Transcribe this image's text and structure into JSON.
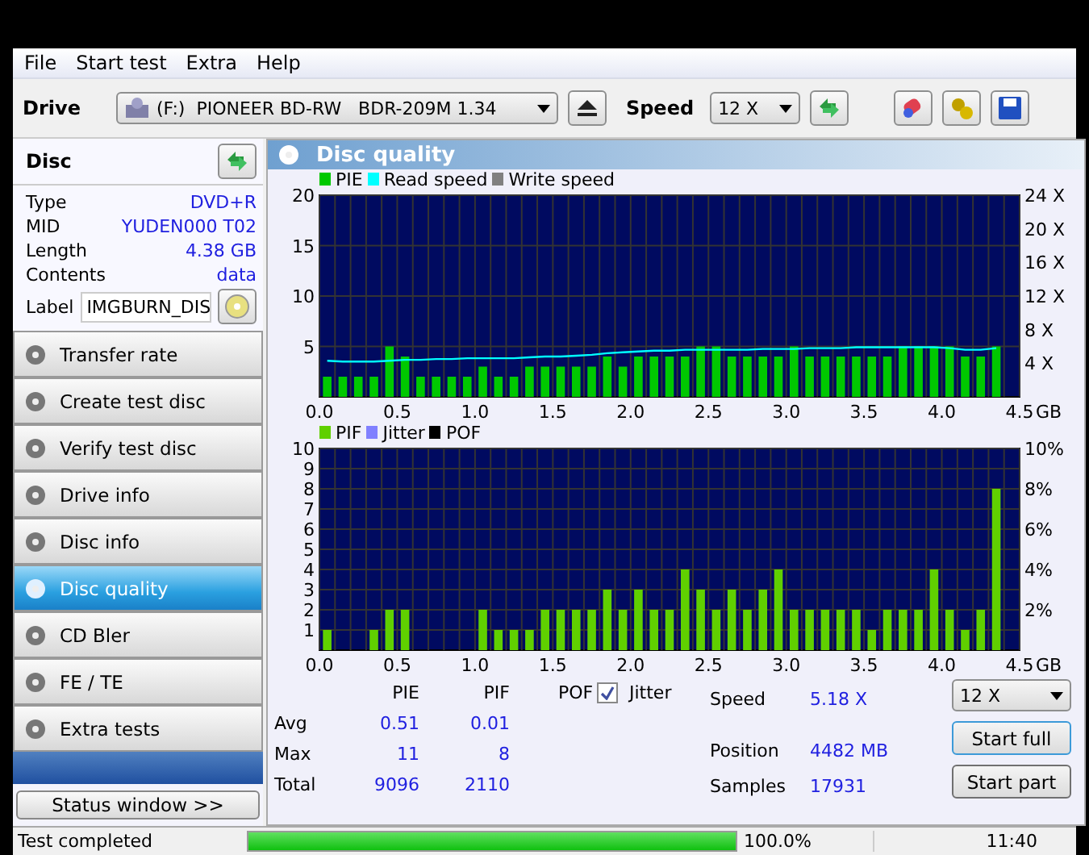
{
  "menu": [
    "File",
    "Start test",
    "Extra",
    "Help"
  ],
  "toolbar": {
    "drive_label": "Drive",
    "drive": "(F:)  PIONEER BD-RW   BDR-209M 1.34",
    "speed_label": "Speed",
    "speed": "12 X"
  },
  "disc": {
    "title": "Disc",
    "fields": [
      {
        "label": "Type",
        "value": "DVD+R"
      },
      {
        "label": "MID",
        "value": "YUDEN000 T02"
      },
      {
        "label": "Length",
        "value": "4.38 GB"
      },
      {
        "label": "Contents",
        "value": "data"
      }
    ],
    "label_label": "Label",
    "label_value": "IMGBURN_DIS"
  },
  "nav": [
    {
      "label": "Transfer rate",
      "selected": false
    },
    {
      "label": "Create test disc",
      "selected": false
    },
    {
      "label": "Verify test disc",
      "selected": false
    },
    {
      "label": "Drive info",
      "selected": false
    },
    {
      "label": "Disc info",
      "selected": false
    },
    {
      "label": "Disc quality",
      "selected": true
    },
    {
      "label": "CD Bler",
      "selected": false
    },
    {
      "label": "FE / TE",
      "selected": false
    },
    {
      "label": "Extra tests",
      "selected": false
    }
  ],
  "status_window": "Status window >>",
  "panel_title": "Disc quality",
  "top_chart": {
    "extra_legend": [
      {
        "name": "Write speed",
        "color": "#808080"
      }
    ],
    "xunit": "GB",
    "chart_data": {
      "type": "bar",
      "grid": true,
      "xlim": [
        0,
        4.5
      ],
      "ylim": [
        0,
        20
      ],
      "y2lim": [
        0,
        24
      ],
      "y2ticks": [
        {
          "value": 24,
          "label": "24 X"
        },
        {
          "value": 20,
          "label": "20 X"
        },
        {
          "value": 16,
          "label": "16 X"
        },
        {
          "value": 12,
          "label": "12 X"
        },
        {
          "value": 8,
          "label": "8 X"
        },
        {
          "value": 4,
          "label": "4 X"
        }
      ],
      "xticks": [
        {
          "value": 0,
          "label": "0.0"
        },
        0.5,
        {
          "value": 1,
          "label": "1.0"
        },
        1.5,
        {
          "value": 2,
          "label": "2.0"
        },
        2.5,
        {
          "value": 3,
          "label": "3.0"
        },
        3.5,
        {
          "value": 4,
          "label": "4.0"
        },
        4.5
      ],
      "yticks": [
        5,
        10,
        15,
        20
      ],
      "x": [
        0.05,
        0.15,
        0.25,
        0.35,
        0.45,
        0.55,
        0.65,
        0.75,
        0.85,
        0.95,
        1.05,
        1.15,
        1.25,
        1.35,
        1.45,
        1.55,
        1.65,
        1.75,
        1.85,
        1.95,
        2.05,
        2.15,
        2.25,
        2.35,
        2.45,
        2.55,
        2.65,
        2.75,
        2.85,
        2.95,
        3.05,
        3.15,
        3.25,
        3.35,
        3.45,
        3.55,
        3.65,
        3.75,
        3.85,
        3.95,
        4.05,
        4.15,
        4.25,
        4.35
      ],
      "series": [
        {
          "name": "PIE",
          "color": "#00c800",
          "values": [
            2,
            2,
            2,
            2,
            5,
            4,
            2,
            2,
            2,
            2,
            3,
            2,
            2,
            3,
            3,
            3,
            3,
            3,
            4,
            3,
            4,
            4,
            4,
            4,
            5,
            5,
            4,
            4,
            4,
            4,
            5,
            4,
            4,
            4,
            4,
            4,
            4,
            5,
            5,
            5,
            5,
            4,
            4,
            5
          ]
        },
        {
          "name": "Read speed",
          "color": "#00ffff",
          "type": "line",
          "axis": "y2",
          "values": [
            4.3,
            4.2,
            4.2,
            4.2,
            4.3,
            4.4,
            4.4,
            4.5,
            4.5,
            4.6,
            4.6,
            4.6,
            4.6,
            4.7,
            4.8,
            4.8,
            4.9,
            5.0,
            5.2,
            5.3,
            5.4,
            5.5,
            5.5,
            5.6,
            5.6,
            5.6,
            5.6,
            5.6,
            5.7,
            5.7,
            5.7,
            5.8,
            5.8,
            5.8,
            5.9,
            5.9,
            5.9,
            5.9,
            5.9,
            5.9,
            5.8,
            5.6,
            5.6,
            5.8
          ]
        }
      ]
    }
  },
  "bottom_chart": {
    "extra_legend": [
      {
        "name": "Jitter",
        "color": "#8080ff"
      },
      {
        "name": "POF",
        "color": "#000000"
      }
    ],
    "xunit": "GB",
    "chart_data": {
      "type": "bar",
      "grid": true,
      "xlim": [
        0,
        4.5
      ],
      "ylim": [
        0,
        10
      ],
      "y2lim": [
        0,
        10
      ],
      "y2ticks": [
        {
          "value": 10,
          "label": "10%"
        },
        {
          "value": 8,
          "label": "8%"
        },
        {
          "value": 6,
          "label": "6%"
        },
        {
          "value": 4,
          "label": "4%"
        },
        {
          "value": 2,
          "label": "2%"
        }
      ],
      "xticks": [
        {
          "value": 0,
          "label": "0.0"
        },
        0.5,
        {
          "value": 1,
          "label": "1.0"
        },
        1.5,
        {
          "value": 2,
          "label": "2.0"
        },
        2.5,
        {
          "value": 3,
          "label": "3.0"
        },
        3.5,
        {
          "value": 4,
          "label": "4.0"
        },
        4.5
      ],
      "yticks": [
        1,
        2,
        3,
        4,
        5,
        6,
        7,
        8,
        9,
        10
      ],
      "x": [
        0.05,
        0.15,
        0.25,
        0.35,
        0.45,
        0.55,
        0.65,
        0.75,
        0.85,
        0.95,
        1.05,
        1.15,
        1.25,
        1.35,
        1.45,
        1.55,
        1.65,
        1.75,
        1.85,
        1.95,
        2.05,
        2.15,
        2.25,
        2.35,
        2.45,
        2.55,
        2.65,
        2.75,
        2.85,
        2.95,
        3.05,
        3.15,
        3.25,
        3.35,
        3.45,
        3.55,
        3.65,
        3.75,
        3.85,
        3.95,
        4.05,
        4.15,
        4.25,
        4.35
      ],
      "series": [
        {
          "name": "PIF",
          "color": "#60d000",
          "values": [
            1,
            0,
            0,
            1,
            2,
            2,
            0,
            0,
            0,
            0,
            2,
            1,
            1,
            1,
            2,
            2,
            2,
            2,
            3,
            2,
            3,
            2,
            2,
            4,
            3,
            2,
            3,
            2,
            3,
            4,
            2,
            2,
            2,
            2,
            2,
            1,
            2,
            2,
            2,
            4,
            2,
            1,
            2,
            8
          ]
        }
      ]
    }
  },
  "stats": {
    "columns": [
      "PIE",
      "PIF",
      "POF"
    ],
    "jitter": {
      "label": "Jitter",
      "checked": true
    },
    "rows": [
      {
        "label": "Avg",
        "values": [
          "0.51",
          "0.01"
        ]
      },
      {
        "label": "Max",
        "values": [
          "11",
          "8"
        ]
      },
      {
        "label": "Total",
        "values": [
          "9096",
          "2110"
        ]
      }
    ],
    "info": [
      {
        "label": "Speed",
        "value": "5.18 X"
      },
      {
        "label": "Position",
        "value": "4482 MB"
      },
      {
        "label": "Samples",
        "value": "17931"
      }
    ],
    "speed": "12 X",
    "buttons": [
      "Start full",
      "Start part"
    ]
  },
  "status_bar": {
    "text": "Test completed",
    "progress": {
      "level": 1.0,
      "reading": "100.0%"
    },
    "time": "11:40"
  }
}
